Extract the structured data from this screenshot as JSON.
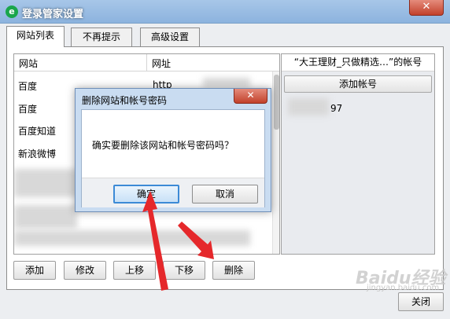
{
  "window": {
    "title": "登录管家设置",
    "close_label": "✕"
  },
  "tabs": [
    {
      "label": "网站列表",
      "active": true
    },
    {
      "label": "不再提示",
      "active": false
    },
    {
      "label": "高级设置",
      "active": false
    }
  ],
  "list": {
    "columns": [
      "网站",
      "网址"
    ],
    "rows": [
      {
        "site": "百度",
        "url": "http"
      },
      {
        "site": "百度",
        "url": ""
      },
      {
        "site": "百度知道",
        "url": ""
      },
      {
        "site": "新浪微博",
        "url": ""
      }
    ]
  },
  "accounts": {
    "header": "“大王理财_只做精选…”的帐号",
    "add_label": "添加帐号",
    "visible_text": "97"
  },
  "buttons": {
    "add": "添加",
    "edit": "修改",
    "move_up": "上移",
    "move_down": "下移",
    "delete": "删除",
    "close": "关闭"
  },
  "dialog": {
    "title": "删除网站和帐号密码",
    "close_label": "✕",
    "message": "确实要删除该网站和帐号密码吗？",
    "ok": "确定",
    "cancel": "取消"
  },
  "watermark": {
    "brand": "Baidu经验",
    "url": "jingyan.baidu.com"
  },
  "colors": {
    "arrow": "#e5282b",
    "titlebar": "#a7c6e8",
    "focus": "#3c8ad6"
  }
}
